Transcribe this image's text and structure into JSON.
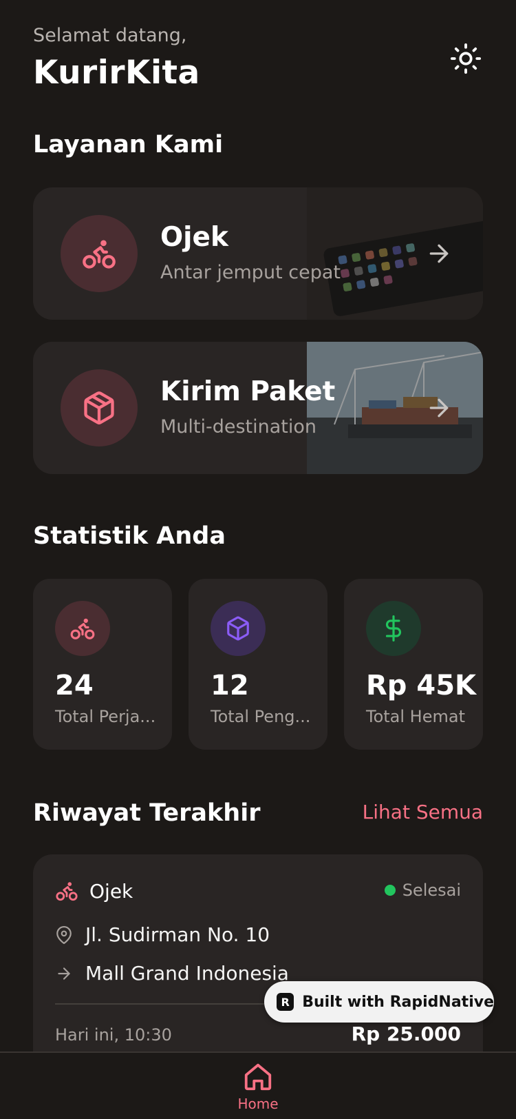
{
  "header": {
    "greeting": "Selamat datang,",
    "brand": "KurirKita",
    "theme_icon": "sun-icon"
  },
  "services": {
    "title": "Layanan Kami",
    "items": [
      {
        "name": "Ojek",
        "subtitle": "Antar jemput cepat",
        "icon": "bike-icon"
      },
      {
        "name": "Kirim Paket",
        "subtitle": "Multi-destination",
        "icon": "package-icon"
      }
    ]
  },
  "stats": {
    "title": "Statistik Anda",
    "items": [
      {
        "value": "24",
        "label": "Total Perja...",
        "icon": "bike-icon",
        "color": "#f87185",
        "bg": "#4a2d31"
      },
      {
        "value": "12",
        "label": "Total Peng...",
        "icon": "package-icon",
        "color": "#8b5cf6",
        "bg": "#3b2d55"
      },
      {
        "value": "Rp 45K",
        "label": "Total Hemat",
        "icon": "dollar-icon",
        "color": "#22c55e",
        "bg": "#1f3a2c"
      }
    ]
  },
  "history": {
    "title": "Riwayat Terakhir",
    "see_all": "Lihat Semua",
    "items": [
      {
        "type": "Ojek",
        "status": "Selesai",
        "from": "Jl. Sudirman No. 10",
        "to": "Mall Grand Indonesia",
        "time": "Hari ini, 10:30",
        "price": "Rp 25.000"
      }
    ]
  },
  "badge": {
    "label": "Built with RapidNative"
  },
  "tabbar": {
    "home_label": "Home"
  },
  "colors": {
    "accent": "#f87185",
    "background": "#1c1917",
    "card": "#292524"
  }
}
